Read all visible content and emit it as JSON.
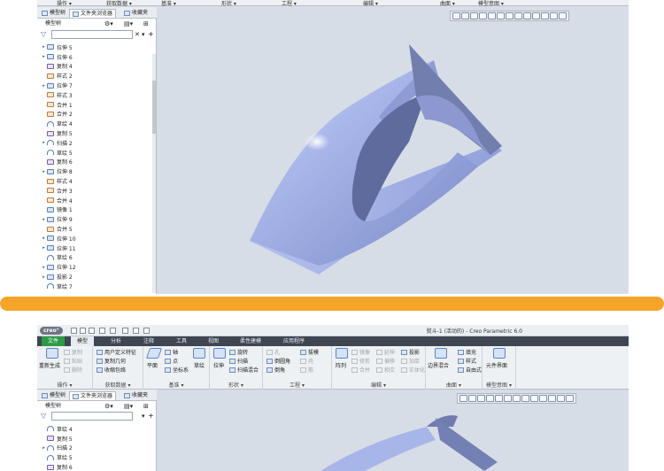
{
  "top": {
    "group_labels": [
      "操作 ▾",
      "获取数据 ▾",
      "基准 ▾",
      "形状 ▾",
      "工程 ▾",
      "编辑 ▾",
      "曲面 ▾",
      "模型意图 ▾"
    ],
    "tree_tabs": [
      "模型树",
      "文件夹浏览器",
      "收藏夹"
    ],
    "tree_header": "模型树",
    "tree_items": [
      {
        "label": "拉伸 5",
        "expand": true,
        "icon": "extrude-icon"
      },
      {
        "label": "拉伸 6",
        "expand": true,
        "icon": "extrude-icon"
      },
      {
        "label": "复制 4",
        "expand": false,
        "icon": "copy-icon"
      },
      {
        "label": "样式 2",
        "expand": false,
        "icon": "style-icon"
      },
      {
        "label": "拉伸 7",
        "expand": true,
        "icon": "extrude-icon"
      },
      {
        "label": "样式 3",
        "expand": false,
        "icon": "style-icon"
      },
      {
        "label": "合并 1",
        "expand": false,
        "icon": "merge-icon"
      },
      {
        "label": "合并 2",
        "expand": false,
        "icon": "merge-icon"
      },
      {
        "label": "草绘 4",
        "expand": false,
        "icon": "sketch-icon"
      },
      {
        "label": "复制 5",
        "expand": false,
        "icon": "copy-icon"
      },
      {
        "label": "扫描 2",
        "expand": true,
        "icon": "sweep-icon"
      },
      {
        "label": "草绘 5",
        "expand": false,
        "icon": "sketch-icon"
      },
      {
        "label": "复制 6",
        "expand": false,
        "icon": "copy-icon"
      },
      {
        "label": "拉伸 8",
        "expand": true,
        "icon": "extrude-icon"
      },
      {
        "label": "样式 4",
        "expand": false,
        "icon": "style-icon"
      },
      {
        "label": "合并 3",
        "expand": false,
        "icon": "merge-icon"
      },
      {
        "label": "合并 4",
        "expand": false,
        "icon": "merge-icon"
      },
      {
        "label": "镜像 1",
        "expand": false,
        "icon": "mirror-icon"
      },
      {
        "label": "拉伸 9",
        "expand": true,
        "icon": "extrude-icon"
      },
      {
        "label": "合并 5",
        "expand": false,
        "icon": "merge-icon"
      },
      {
        "label": "拉伸 10",
        "expand": true,
        "icon": "extrude-icon"
      },
      {
        "label": "拉伸 11",
        "expand": true,
        "icon": "extrude-icon"
      },
      {
        "label": "草绘 6",
        "expand": false,
        "icon": "sketch-icon"
      },
      {
        "label": "拉伸 12",
        "expand": true,
        "icon": "extrude-icon"
      },
      {
        "label": "投影 2",
        "expand": true,
        "icon": "project-icon"
      },
      {
        "label": "草绘 7",
        "expand": false,
        "icon": "sketch-icon"
      }
    ]
  },
  "bottom": {
    "logo": "creo°",
    "window_title": "熨斗-1 (活动的) - Creo Parametric 6.0",
    "ribbon_tabs": {
      "file": "文件",
      "active": "模型",
      "others": [
        "分析",
        "注释",
        "工具",
        "视图",
        "柔性建模",
        "应用程序"
      ]
    },
    "groups": {
      "operations": {
        "label": "操作 ▾",
        "regenerate": "重新生成",
        "copy": "复制",
        "paste": "粘贴",
        "delete": "删除"
      },
      "get_data": {
        "label": "获取数据 ▾",
        "udf": "用户定义特征",
        "copy_geom": "复制几何",
        "shrinkwrap": "收缩包络"
      },
      "datum": {
        "label": "基准 ▾",
        "plane": "平面",
        "axis": "轴",
        "point": "点",
        "csys": "坐标系",
        "sketch": "草绘"
      },
      "shapes": {
        "label": "形状 ▾",
        "extrude": "拉伸",
        "revolve": "旋转",
        "sweep": "扫描",
        "swept_blend": "扫描混合"
      },
      "engineering": {
        "label": "工程 ▾",
        "hole": "孔",
        "round": "倒圆角",
        "chamfer": "倒角",
        "draft": "拔模",
        "shell": "壳",
        "rib": "筋"
      },
      "editing": {
        "label": "编辑 ▾",
        "pattern": "阵列",
        "mirror": "镜像",
        "extend": "延伸",
        "project": "投影",
        "trim": "修剪",
        "offset": "偏移",
        "thicken": "加厚",
        "merge": "合并",
        "intersect": "相交",
        "solidify": "实体化"
      },
      "surfaces": {
        "label": "曲面 ▾",
        "boundary_blend": "边界混合",
        "fill": "填充",
        "style": "样式",
        "freestyle": "自由式"
      },
      "model_intent": {
        "label": "模型意图 ▾",
        "component_interface": "元件界面"
      }
    },
    "tree_tabs": [
      "模型树",
      "文件夹浏览器",
      "收藏夹"
    ],
    "tree_header": "模型树",
    "tree_items": [
      {
        "label": "草绘 4",
        "icon": "sketch-icon"
      },
      {
        "label": "复制 5",
        "icon": "copy-icon"
      },
      {
        "label": "扫描 2",
        "icon": "sweep-icon",
        "expand": true
      },
      {
        "label": "草绘 5",
        "icon": "sketch-icon"
      },
      {
        "label": "复制 6",
        "icon": "copy-icon"
      }
    ]
  },
  "colors": {
    "accent_orange": "#f5a52a",
    "model_fill": "#a9b6e6",
    "file_tab": "#2d9a46",
    "ribbon_dark": "#3e4652"
  }
}
